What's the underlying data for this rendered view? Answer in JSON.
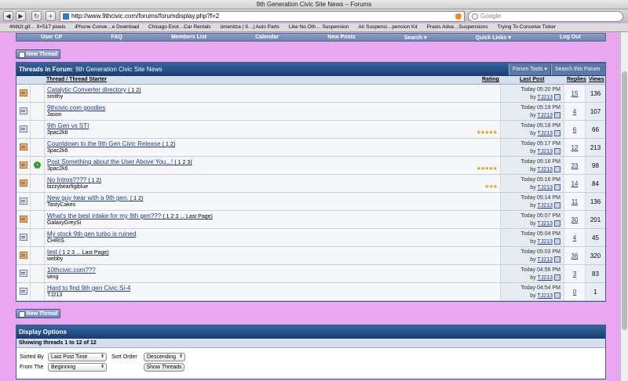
{
  "browser": {
    "window_title": "9th Generation Civic Site News – Forums",
    "url": "http://www.9thcivic.com/forums/forumdisplay.php?f=2",
    "search_placeholder": "Google",
    "bookmarks": [
      "4hltt2r.gif… 9×517 pixels",
      "iPhone Conve…e Download",
      "Chicago Exot…Car Rentals",
      "ümenitza | 9…| Auto Parts",
      "Like No Oth… Suspension",
      "Air Suspensi…pension Kit",
      "Praxis Adva…Suspensions",
      "Trying To Conceive Ticker"
    ]
  },
  "navbar": [
    "User CP",
    "FAQ",
    "Members List",
    "Calendar",
    "New Posts",
    "Search ▾",
    "Quick Links ▾",
    "Log Out"
  ],
  "new_thread_label": "New Thread",
  "forum": {
    "header_prefix": "Threads in Forum",
    "header_forum": ": 9th Generation Civic Site News",
    "tools": [
      "Forum Tools ▾",
      "Search this Forum ▾"
    ],
    "columns": {
      "thread": "Thread / Thread Starter",
      "rating": "Rating",
      "last_post": "Last Post",
      "replies": "Replies",
      "views": "Views"
    },
    "threads": [
      {
        "title": "Catalytic Converter directory",
        "pages": "( 1 2)",
        "starter": "smithy",
        "rating": "",
        "date": "Today 05:20 PM",
        "by": "by",
        "user": "TJ213",
        "replies": "15",
        "views": "136",
        "hot": true,
        "go": false
      },
      {
        "title": "9thcivic.com goodies",
        "pages": "",
        "starter": "Jason",
        "rating": "",
        "date": "Today 05:19 PM",
        "by": "by",
        "user": "TJ213",
        "replies": "4",
        "views": "107",
        "hot": false,
        "go": false
      },
      {
        "title": "9th Gen vs STI",
        "pages": "",
        "starter": "3pac2k6",
        "rating": "★★★★★",
        "date": "Today 05:18 PM",
        "by": "by",
        "user": "TJ213",
        "replies": "6",
        "views": "66",
        "hot": false,
        "go": false
      },
      {
        "title": "Countdown to the 9th Gen Civic Release",
        "pages": "( 1 2)",
        "starter": "3pac2k6",
        "rating": "",
        "date": "Today 05:17 PM",
        "by": "by",
        "user": "TJ213",
        "replies": "12",
        "views": "213",
        "hot": true,
        "go": false
      },
      {
        "title": "Post Something about the User Above You...!",
        "pages": "( 1 2 3)",
        "starter": "3pac2k6",
        "rating": "★★★★★",
        "date": "Today 05:16 PM",
        "by": "by",
        "user": "TJ213",
        "replies": "23",
        "views": "98",
        "hot": true,
        "go": true
      },
      {
        "title": "No Intros????",
        "pages": "( 1 2)",
        "starter": "bizzybearfigiblue",
        "rating": "★★★",
        "date": "Today 05:16 PM",
        "by": "by",
        "user": "TJ213",
        "replies": "14",
        "views": "84",
        "hot": true,
        "go": false
      },
      {
        "title": "New guy hear with a 9th gen.",
        "pages": "( 1 2)",
        "starter": "TastyCakes",
        "rating": "",
        "date": "Today 05:14 PM",
        "by": "by",
        "user": "TJ213",
        "replies": "11",
        "views": "136",
        "hot": false,
        "go": false
      },
      {
        "title": "What's the best intake for my 9th gen???",
        "pages": "( 1 2 3 ... Last Page)",
        "starter": "GalaxyGreySi",
        "rating": "",
        "date": "Today 05:07 PM",
        "by": "by",
        "user": "TJ213",
        "replies": "30",
        "views": "201",
        "hot": true,
        "go": false
      },
      {
        "title": "My stock 9th gen turbo is ruined",
        "pages": "",
        "starter": "CHRIS",
        "rating": "",
        "date": "Today 05:04 PM",
        "by": "by",
        "user": "TJ213",
        "replies": "4",
        "views": "45",
        "hot": false,
        "go": false
      },
      {
        "title": "test",
        "pages": "( 1 2 3 ... Last Page)",
        "starter": "webby",
        "rating": "",
        "date": "Today 05:03 PM",
        "by": "by",
        "user": "TJ213",
        "replies": "36",
        "views": "320",
        "hot": true,
        "go": false
      },
      {
        "title": "10thcivic.com???",
        "pages": "",
        "starter": "wing",
        "rating": "",
        "date": "Today 04:56 PM",
        "by": "by",
        "user": "TJ213",
        "replies": "3",
        "views": "83",
        "hot": false,
        "go": false
      },
      {
        "title": "Hard to find 9th gen Civic Si-4",
        "pages": "",
        "starter": "TJ213",
        "rating": "",
        "date": "Today 04:54 PM",
        "by": "by",
        "user": "TJ213",
        "replies": "0",
        "views": "1",
        "hot": false,
        "go": false
      }
    ]
  },
  "display_options": {
    "title": "Display Options",
    "showing": "Showing threads 1 to 12 of 12",
    "sorted_by_label": "Sorted By",
    "sorted_by_value": "Last Post Time",
    "sort_order_label": "Sort Order",
    "sort_order_value": "Descending",
    "from_label": "From The",
    "from_value": "Beginning",
    "show_button": "Show Threads"
  },
  "colors": {
    "page_bg": "#e8a7ee",
    "header_blue": "#183d73",
    "link_blue": "#1d3a8a"
  }
}
